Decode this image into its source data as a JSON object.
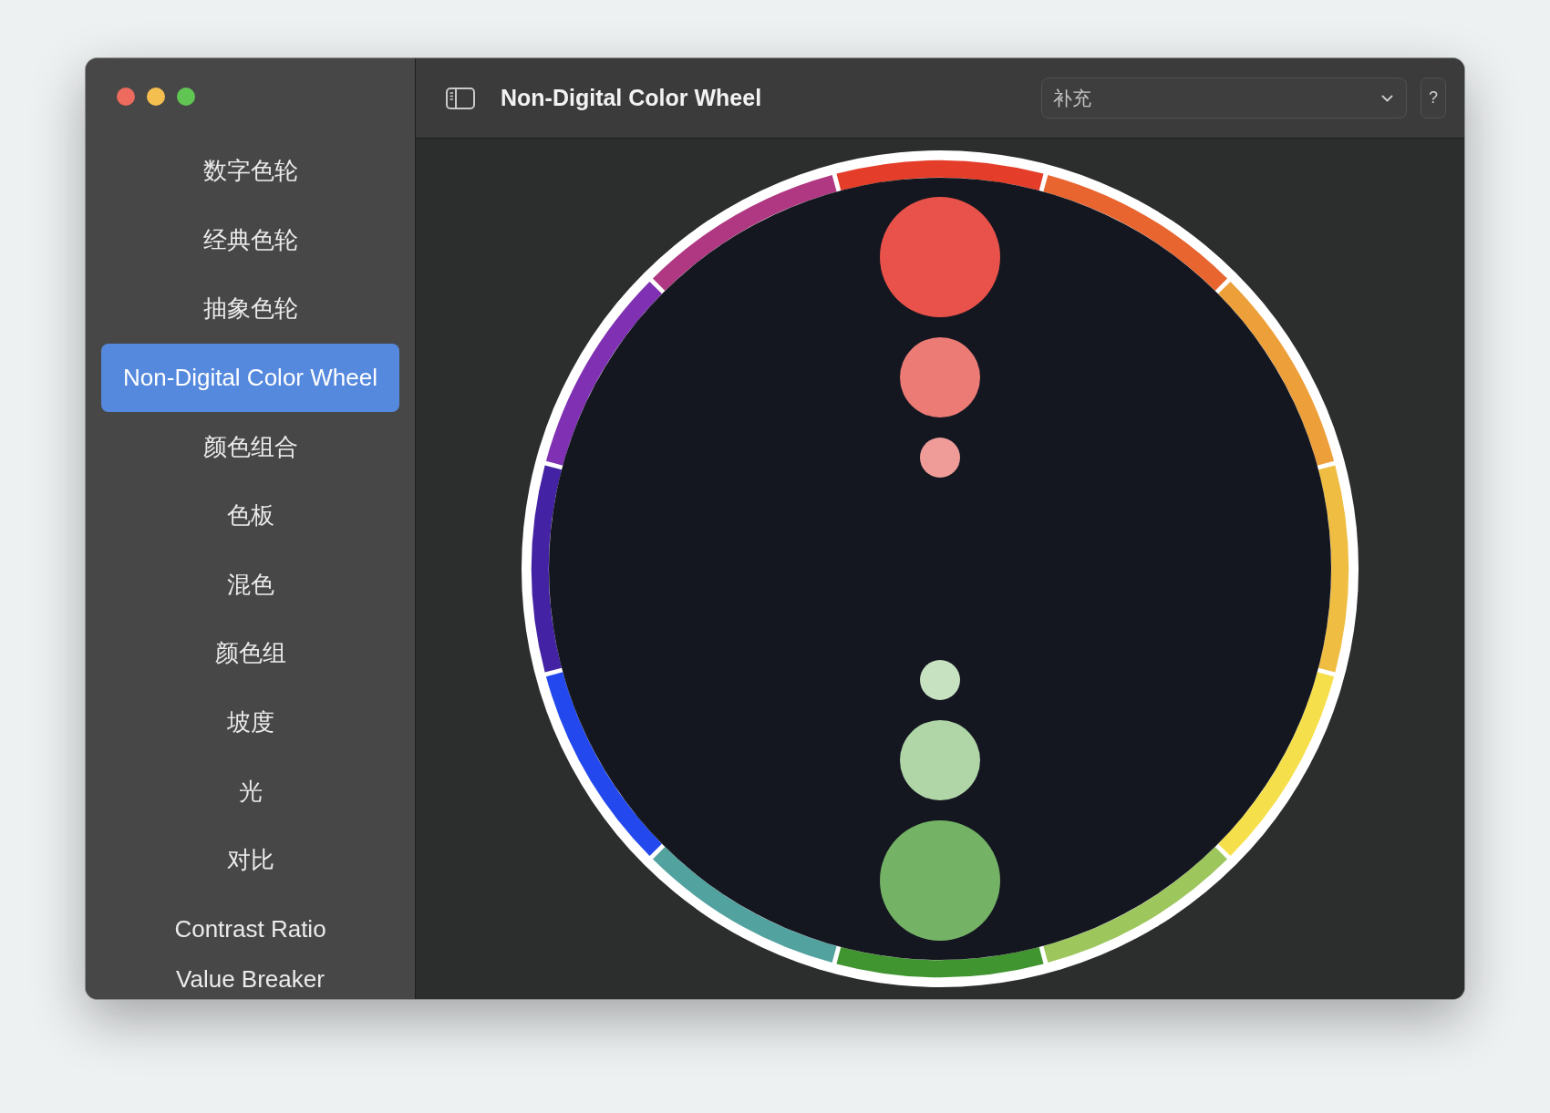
{
  "window": {
    "title": "Non-Digital Color Wheel"
  },
  "sidebar": {
    "items": [
      {
        "label": "数字色轮",
        "selected": false
      },
      {
        "label": "经典色轮",
        "selected": false
      },
      {
        "label": "抽象色轮",
        "selected": false
      },
      {
        "label": "Non-Digital Color Wheel",
        "selected": true
      },
      {
        "label": "颜色组合",
        "selected": false
      },
      {
        "label": "色板",
        "selected": false
      },
      {
        "label": "混色",
        "selected": false
      },
      {
        "label": "颜色组",
        "selected": false
      },
      {
        "label": "坡度",
        "selected": false
      },
      {
        "label": "光",
        "selected": false
      },
      {
        "label": "对比",
        "selected": false
      },
      {
        "label": "Contrast Ratio",
        "selected": false
      },
      {
        "label": "Value Breaker",
        "selected": false
      }
    ]
  },
  "toolbar": {
    "scheme_select": {
      "value": "补充"
    },
    "help_button": "?"
  },
  "wheel": {
    "segments": [
      {
        "color": "#e43e2b"
      },
      {
        "color": "#e8652f"
      },
      {
        "color": "#eda03a"
      },
      {
        "color": "#efbd42"
      },
      {
        "color": "#f5e04c"
      },
      {
        "color": "#9dc65c"
      },
      {
        "color": "#419530"
      },
      {
        "color": "#52a29f"
      },
      {
        "color": "#2349ee"
      },
      {
        "color": "#4322a3"
      },
      {
        "color": "#7f30b3"
      },
      {
        "color": "#b03882"
      }
    ],
    "circles": [
      {
        "kind": "large",
        "color": "#e8524a"
      },
      {
        "kind": "medium",
        "color": "#ec7b76"
      },
      {
        "kind": "small",
        "color": "#ef9c98"
      },
      {
        "kind": "small",
        "color": "#c7e2c1"
      },
      {
        "kind": "medium",
        "color": "#b0d6a8"
      },
      {
        "kind": "large",
        "color": "#74b365"
      }
    ]
  }
}
